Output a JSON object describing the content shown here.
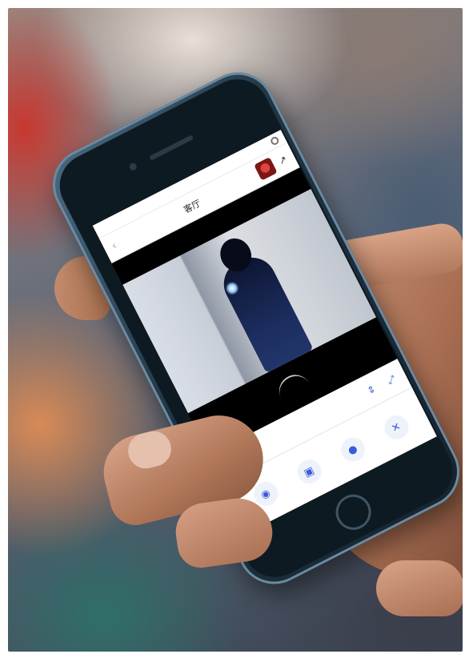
{
  "photo": {
    "subject": "",
    "colors": {
      "phone_body": "#1f3443",
      "screen_accent": "#3a5bd9",
      "notification": "#e23b3b"
    }
  },
  "phone_screen": {
    "status_left": "",
    "notification_badge": "",
    "status_right": "",
    "nav_title": "客厅",
    "back_icon": "chevron-left-icon",
    "video_header_left": "",
    "video_header_right": "",
    "hd_badge": "",
    "controls": [
      "vertical-resize-icon",
      "fullscreen-icon"
    ],
    "actions": [
      "camera-icon",
      "video-record-icon",
      "microphone-icon",
      "tools-icon"
    ]
  }
}
